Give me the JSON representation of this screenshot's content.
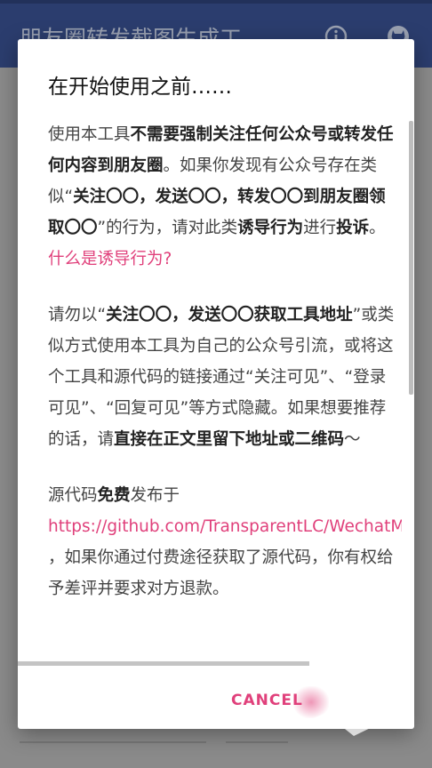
{
  "appbar": {
    "title": "朋友圈转发截图生成工...",
    "info_icon": "info-icon",
    "github_icon": "github-icon"
  },
  "dialog": {
    "title": "在开始使用之前……",
    "p1": {
      "t1": "使用本工具",
      "b1": "不需要强制关注任何公众号或转发任何内容到朋友圈",
      "t2": "。如果你发现有公众号存在类似“",
      "b2": "关注〇〇，发送〇〇，转发〇〇到朋友圈领取〇〇",
      "t3": "”的行为，请对此类",
      "b3": "诱导行为",
      "t4": "进行",
      "b4": "投诉",
      "t5": "。",
      "link": "什么是诱导行为?"
    },
    "p2": {
      "t1": "请勿以“",
      "b1": "关注〇〇，发送〇〇获取工具地址",
      "t2": "”或类似方式使用本工具为自己的公众号引流，或将这个工具和源代码的链接通过“关注可见”、“登录可见”、“回复可见”等方式隐藏。如果想要推荐的话，请",
      "b2": "直接在正文里留下地址或二维码",
      "t3": "～"
    },
    "p3": {
      "t1": "源代码",
      "b1": "免费",
      "t2": "发布于",
      "link": "https://github.com/TransparentLC/WechatMomentScreenshot",
      "t3": "，如果你通过付费途径获取了源代码，你有权给予差评并要求对方退款。"
    },
    "cancel_label": "CANCEL"
  },
  "colors": {
    "accent": "#e0407b",
    "appbar": "#2b3d6e",
    "scrim": "#8a8a8a"
  }
}
